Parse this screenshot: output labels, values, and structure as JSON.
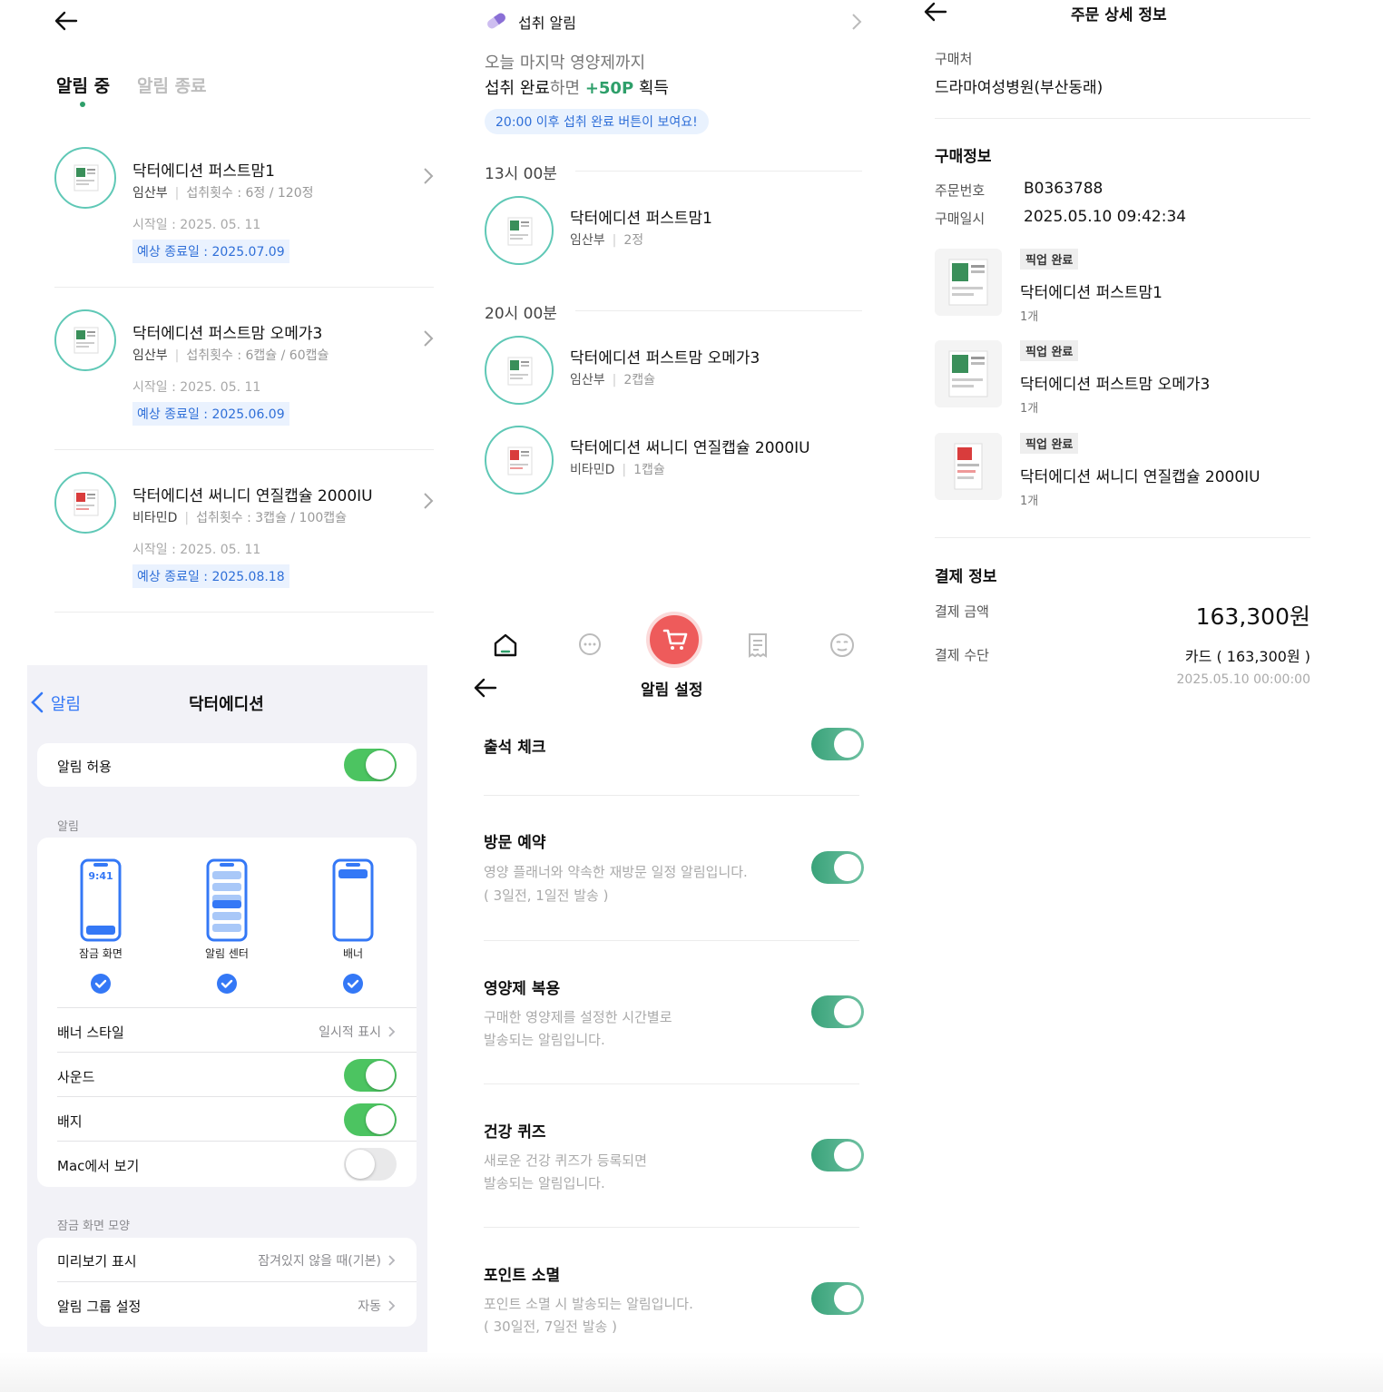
{
  "alarm_list": {
    "tabs": [
      {
        "label": "알림 중",
        "active": true
      },
      {
        "label": "알림 종료",
        "active": false
      }
    ],
    "items": [
      {
        "name": "닥터에디션 퍼스트맘1",
        "category": "임산부",
        "dose": "섭취횟수 : 6정 / 120정",
        "start": "시작일 : 2025. 05. 11",
        "end": "예상 종료일 : 2025.07.09"
      },
      {
        "name": "닥터에디션 퍼스트맘 오메가3",
        "category": "임산부",
        "dose": "섭취횟수 : 6캡슐 / 60캡슐",
        "start": "시작일 : 2025. 05. 11",
        "end": "예상 종료일 : 2025.06.09"
      },
      {
        "name": "닥터에디션 써니디 연질캡슐 2000IU",
        "category": "비타민D",
        "dose": "섭취횟수 : 3캡슐 / 100캡슐",
        "start": "시작일 : 2025. 05. 11",
        "end": "예상 종료일 : 2025.08.18"
      }
    ]
  },
  "intake": {
    "header": "섭취 알림",
    "line1": "오늘 마지막 영양제까지",
    "line2_strong": "섭취 완료",
    "line2_soft": "하면 ",
    "line2_points": "+50P",
    "line2_tail": " 획득",
    "notice": "20:00 이후 섭취 완료 버튼이 보여요!",
    "groups": [
      {
        "time": "13시 00분",
        "items": [
          {
            "name": "닥터에디션 퍼스트맘1",
            "category": "임산부",
            "dose": "2정"
          }
        ]
      },
      {
        "time": "20시 00분",
        "items": [
          {
            "name": "닥터에디션 퍼스트맘 오메가3",
            "category": "임산부",
            "dose": "2캡슐"
          },
          {
            "name": "닥터에디션 써니디 연질캡슐 2000IU",
            "category": "비타민D",
            "dose": "1캡슐"
          }
        ]
      }
    ],
    "nav": [
      "home-icon",
      "chat-icon",
      "cart-icon",
      "receipt-icon",
      "smile-icon"
    ]
  },
  "order": {
    "title": "주문 상세 정보",
    "store_label": "구매처",
    "store_value": "드라마여성병원(부산동래)",
    "purchase_section": "구매정보",
    "order_no_label": "주문번호",
    "order_no_value": "B0363788",
    "order_date_label": "구매일시",
    "order_date_value": "2025.05.10 09:42:34",
    "items": [
      {
        "badge": "픽업 완료",
        "name": "닥터에디션 퍼스트맘1",
        "qty": "1개"
      },
      {
        "badge": "픽업 완료",
        "name": "닥터에디션 퍼스트맘 오메가3",
        "qty": "1개"
      },
      {
        "badge": "픽업 완료",
        "name": "닥터에디션 써니디 연질캡슐 2000IU",
        "qty": "1개"
      }
    ],
    "payment_section": "결제 정보",
    "amount_label": "결제 금액",
    "amount_value": "163,300원",
    "method_label": "결제 수단",
    "method_value": "카드 ( 163,300원 )",
    "method_date": "2025.05.10 00:00:00"
  },
  "ios": {
    "back_label": "알림",
    "title": "닥터에디션",
    "allow_label": "알림 허용",
    "alerts_caption": "알림",
    "phones": [
      {
        "label": "잠금 화면",
        "time": "9:41"
      },
      {
        "label": "알림 센터"
      },
      {
        "label": "배너"
      }
    ],
    "banner_style_label": "배너 스타일",
    "banner_style_value": "일시적 표시",
    "sound_label": "사운드",
    "badge_label": "배지",
    "mac_label": "Mac에서 보기",
    "lock_caption": "잠금 화면 모양",
    "preview_label": "미리보기 표시",
    "preview_value": "잠겨있지 않을 때(기본)",
    "group_label": "알림 그룹 설정",
    "group_value": "자동",
    "toggles": {
      "allow": true,
      "sound": true,
      "badge": true,
      "mac": false
    }
  },
  "settings": {
    "title": "알림 설정",
    "items": [
      {
        "title": "출석 체크",
        "desc1": "",
        "desc2": ""
      },
      {
        "title": "방문 예약",
        "desc1": "영양 플래너와 약속한 재방문 일정 알림입니다.",
        "desc2": "( 3일전, 1일전 발송 )"
      },
      {
        "title": "영양제 복용",
        "desc1": "구매한 영양제를 설정한 시간별로",
        "desc2": "발송되는 알림입니다."
      },
      {
        "title": "건강 퀴즈",
        "desc1": "새로운 건강 퀴즈가 등록되면",
        "desc2": "발송되는 알림입니다."
      },
      {
        "title": "포인트 소멸",
        "desc1": "포인트 소멸 시 발송되는 알림입니다.",
        "desc2": "( 30일전, 7일전 발송 )"
      }
    ]
  },
  "colors": {
    "accent_green": "#2e9f6a",
    "ring_teal": "#5fc8b6",
    "link_blue": "#2f6fd8",
    "ios_green": "#4cc461",
    "cart_red": "#ee5b5b"
  }
}
